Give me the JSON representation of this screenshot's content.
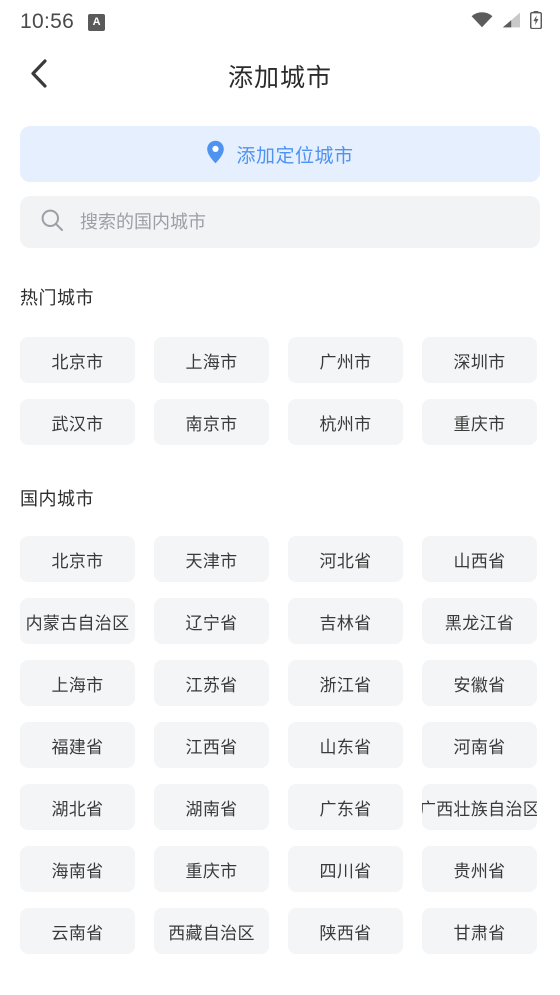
{
  "status_bar": {
    "time": "10:56",
    "app_badge": "A",
    "icons": [
      "wifi-icon",
      "signal-icon",
      "battery-charging-icon"
    ]
  },
  "header": {
    "back_icon": "chevron-left-icon",
    "title": "添加城市"
  },
  "locate": {
    "icon": "location-pin-icon",
    "label": "添加定位城市",
    "bg_color": "#e6effe",
    "text_color": "#4f93f0"
  },
  "search": {
    "icon": "search-icon",
    "value": "",
    "placeholder": "搜索的国内城市"
  },
  "hot_section": {
    "title": "热门城市",
    "cities": [
      "北京市",
      "上海市",
      "广州市",
      "深圳市",
      "武汉市",
      "南京市",
      "杭州市",
      "重庆市"
    ]
  },
  "domestic_section": {
    "title": "国内城市",
    "cities": [
      "北京市",
      "天津市",
      "河北省",
      "山西省",
      "内蒙古自治区",
      "辽宁省",
      "吉林省",
      "黑龙江省",
      "上海市",
      "江苏省",
      "浙江省",
      "安徽省",
      "福建省",
      "江西省",
      "山东省",
      "河南省",
      "湖北省",
      "湖南省",
      "广东省",
      "广西壮族自治区",
      "海南省",
      "重庆市",
      "四川省",
      "贵州省",
      "云南省",
      "西藏自治区",
      "陕西省",
      "甘肃省"
    ]
  },
  "theme": {
    "chip_bg": "#f4f5f7",
    "search_bg": "#f2f3f5",
    "accent": "#4f93f0"
  }
}
